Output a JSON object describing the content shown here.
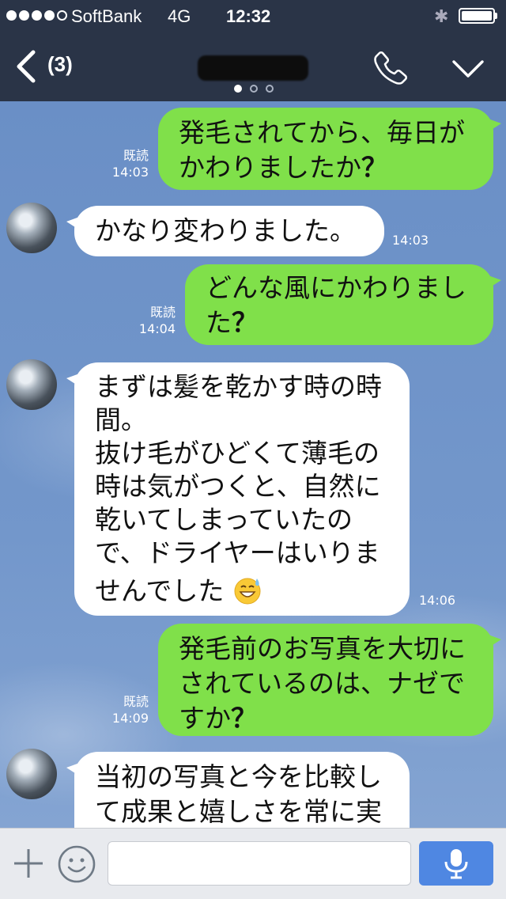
{
  "status": {
    "carrier": "SoftBank",
    "network": "4G",
    "time": "12:32",
    "bluetooth_symbol": "✱"
  },
  "navbar": {
    "back_count": "(3)",
    "title_obscured": true,
    "pager": {
      "count": 3,
      "active": 0
    },
    "icons": [
      "back-chevron-icon",
      "phone-icon",
      "chevron-down-icon"
    ]
  },
  "messages": [
    {
      "side": "me",
      "lines": [
        "発毛されてから、毎日が",
        "かわりましたか"
      ],
      "question_mark": "？",
      "read": "既読",
      "time": "14:03"
    },
    {
      "side": "them",
      "lines": [
        "かなり変わりました。"
      ],
      "time": "14:03"
    },
    {
      "side": "me",
      "lines": [
        "どんな風にかわりまし",
        "た"
      ],
      "question_mark": "？",
      "read": "既読",
      "time": "14:04"
    },
    {
      "side": "them",
      "lines": [
        "まずは髪を乾かす時の時",
        "間。",
        "抜け毛がひどくて薄毛の",
        "時は気がつくと、自然に",
        "乾いてしまっていたの",
        "で、ドライヤーはいりま",
        "せんでした"
      ],
      "emoji": "grinning-sweat-emoji",
      "time": "14:06"
    },
    {
      "side": "me",
      "lines": [
        "発毛前のお写真を大切に",
        "されているのは、ナゼで",
        "すか"
      ],
      "question_mark": "？",
      "read": "既読",
      "time": "14:09"
    },
    {
      "side": "them",
      "lines": [
        "当初の写真と今を比較し",
        "て成果と嬉しさを常に実"
      ],
      "partial": true
    }
  ],
  "inputbar": {
    "icons": [
      "plus-icon",
      "smiley-icon",
      "microphone-icon"
    ],
    "text_value": ""
  },
  "colors": {
    "header": "#2a3447",
    "my_bubble": "#80e04a",
    "their_bubble": "#ffffff",
    "mic_button": "#4f87e2"
  }
}
